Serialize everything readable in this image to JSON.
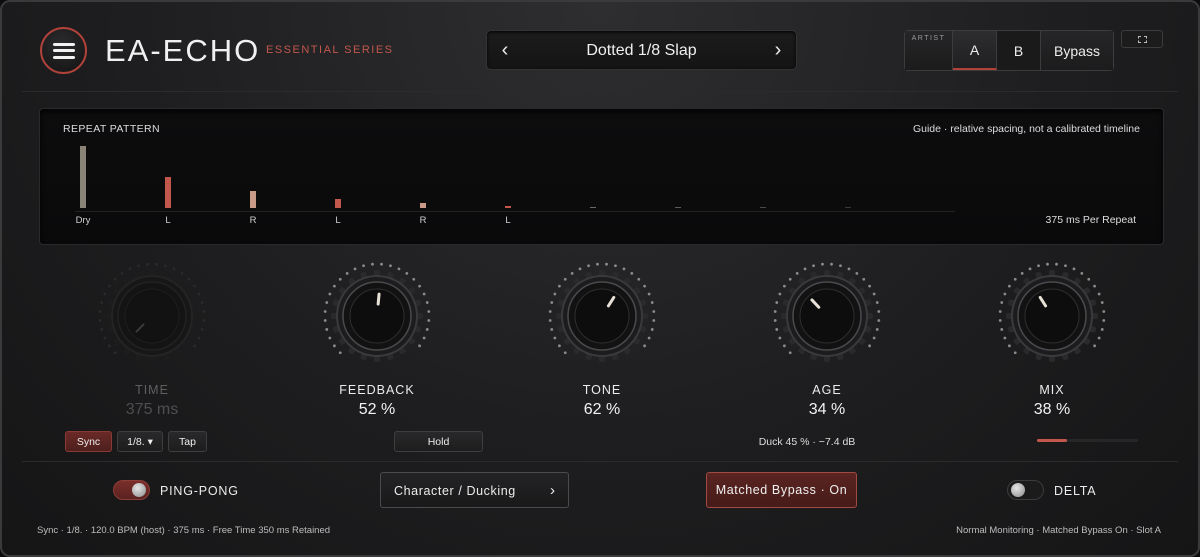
{
  "header": {
    "title": "EA-ECHO",
    "series": "ESSENTIAL SERIES",
    "preset": {
      "name": "Dotted 1/8 Slap",
      "prev_icon": "‹",
      "next_icon": "›"
    },
    "artist_label": "ARTIST",
    "slot_a": "A",
    "slot_b": "B",
    "bypass_label": "Bypass",
    "icons": [
      "menu-icon",
      "expand-icon"
    ]
  },
  "display": {
    "title": "REPEAT PATTERN",
    "guide": "Guide · relative spacing, not a calibrated timeline",
    "per_repeat": "375 ms Per Repeat",
    "repeats": [
      {
        "label": "Dry",
        "level": 1.0,
        "color": "#8a8378"
      },
      {
        "label": "L",
        "level": 0.5,
        "color": "#c2574c"
      },
      {
        "label": "R",
        "level": 0.27,
        "color": "#c99a88"
      },
      {
        "label": "L",
        "level": 0.14,
        "color": "#c2574c"
      },
      {
        "label": "R",
        "level": 0.075,
        "color": "#c99a88"
      },
      {
        "label": "L",
        "level": 0.04,
        "color": "#c2574c"
      },
      {
        "label": "",
        "level": 0.02,
        "color": "#6a6a6a"
      },
      {
        "label": "",
        "level": 0.012,
        "color": "#5a5a5a"
      },
      {
        "label": "",
        "level": 0.008,
        "color": "#4a4a4a"
      },
      {
        "label": "",
        "level": 0.005,
        "color": "#3a3a3a"
      }
    ]
  },
  "knobs": [
    {
      "key": "time",
      "label": "TIME",
      "value": "375 ms",
      "position": 0.0,
      "active": false
    },
    {
      "key": "feedback",
      "label": "FEEDBACK",
      "value": "52 %",
      "position": 0.52,
      "active": true
    },
    {
      "key": "tone",
      "label": "TONE",
      "value": "62 %",
      "position": 0.62,
      "active": true
    },
    {
      "key": "age",
      "label": "AGE",
      "value": "34 %",
      "position": 0.34,
      "active": true
    },
    {
      "key": "mix",
      "label": "MIX",
      "value": "38 %",
      "position": 0.38,
      "active": true
    }
  ],
  "time_controls": {
    "sync": "Sync",
    "division": "1/8. ▾",
    "tap": "Tap"
  },
  "hold_label": "Hold",
  "duck_text": "Duck 45 % · −7.4 dB",
  "mix_meter": 0.3,
  "footer": {
    "pingpong_label": "PING-PONG",
    "pingpong_on": true,
    "character_label": "Character / Ducking",
    "character_arrow": "›",
    "matched_bypass_label": "Matched Bypass · On",
    "delta_label": "DELTA",
    "delta_on": false
  },
  "status": {
    "left": "Sync · 1/8. · 120.0 BPM (host) · 375 ms · Free Time 350 ms Retained",
    "right": "Normal Monitoring · Matched Bypass On · Slot A"
  },
  "colors": {
    "accent": "#c2574c",
    "background": "#1e1e20"
  }
}
